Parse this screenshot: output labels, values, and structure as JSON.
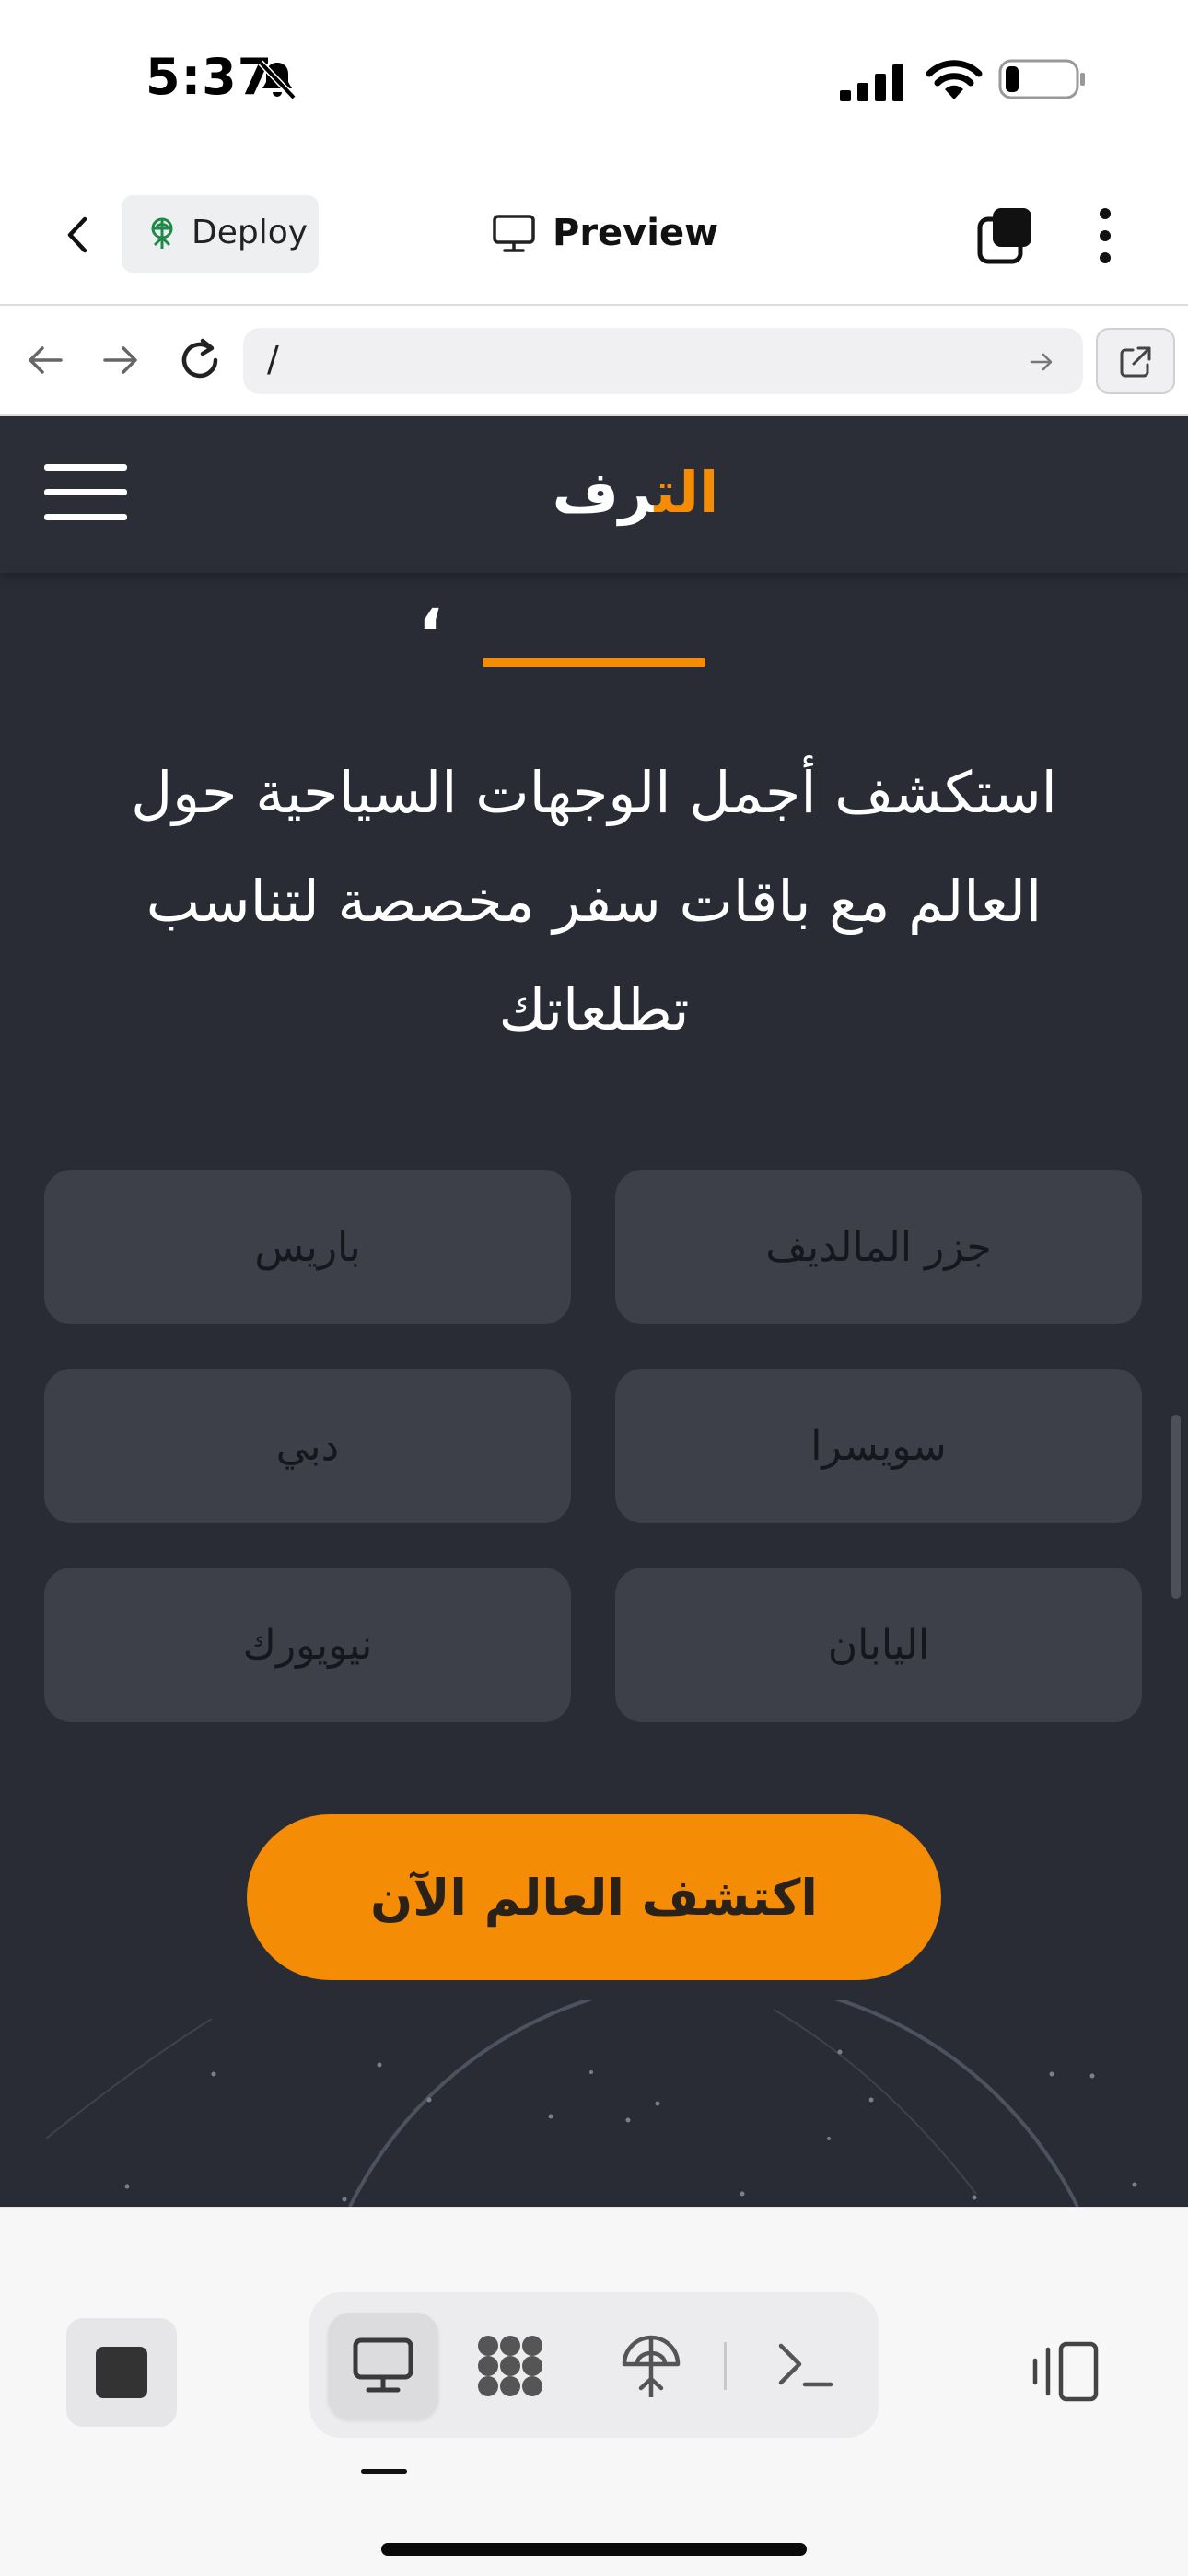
{
  "status_bar": {
    "time": "5:37",
    "icons": [
      "bell-slash-icon",
      "cellular-signal-icon",
      "wifi-icon",
      "battery-low-icon"
    ]
  },
  "app_bar": {
    "deploy_label": "Deploy",
    "preview_label": "Preview",
    "icons": [
      "chevron-left-icon",
      "deploy-icon",
      "monitor-icon",
      "tabs-icon",
      "more-vertical-icon"
    ]
  },
  "browser": {
    "url": "/",
    "icons": [
      "arrow-left-icon",
      "arrow-right-icon",
      "reload-icon",
      "go-arrow-icon",
      "open-external-icon"
    ]
  },
  "site": {
    "logo_prefix": "ال",
    "logo_accent": "ت",
    "logo_suffix": "رف",
    "quote_mark": "،",
    "description": "استكشف أجمل الوجهات السياحية حول العالم مع باقات سفر مخصصة لتناسب تطلعاتك",
    "destinations": [
      "جزر المالديف",
      "باريس",
      "سويسرا",
      "دبي",
      "اليابان",
      "نيويورك"
    ],
    "cta_label": "اكتشف العالم الآن",
    "colors": {
      "background": "#292c35",
      "card": "#3d4049",
      "accent": "#f48c06"
    }
  },
  "toolbar": {
    "items": [
      "stop-icon",
      "desktop-icon",
      "agents-icon",
      "deploy-icon",
      "shell-icon",
      "panel-toggle-icon"
    ],
    "active_item": "desktop"
  }
}
